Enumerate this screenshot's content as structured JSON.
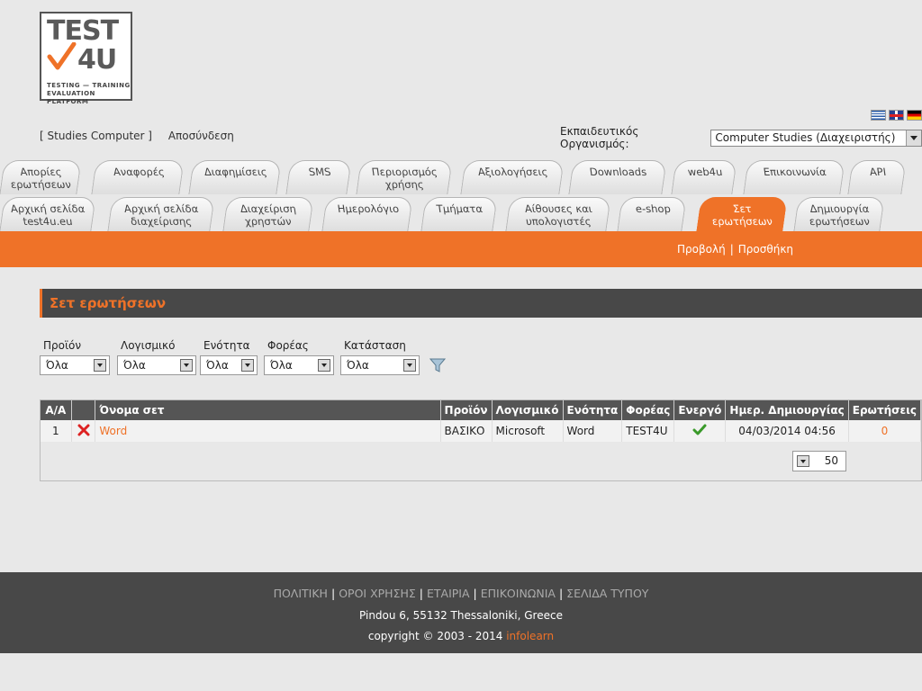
{
  "logo": {
    "line1": "TEST",
    "line2": "4U",
    "tagline1": "TESTING — TRAINING",
    "tagline2": "EVALUATION PLATFORM"
  },
  "user": {
    "name": "[ Studies Computer ]",
    "logout": "Αποσύνδεση"
  },
  "org": {
    "label": "Εκπαιδευτικός Οργανισμός:",
    "value": "Computer Studies (Διαχειριστής)"
  },
  "tabs_row1": [
    {
      "label1": "Απορίες",
      "label2": "ερωτήσεων"
    },
    {
      "label1": "Αναφορές",
      "label2": ""
    },
    {
      "label1": "Διαφημίσεις",
      "label2": ""
    },
    {
      "label1": "SMS",
      "label2": ""
    },
    {
      "label1": "Περιορισμός",
      "label2": "χρήσης"
    },
    {
      "label1": "Αξιολογήσεις",
      "label2": ""
    },
    {
      "label1": "Downloads",
      "label2": ""
    },
    {
      "label1": "web4u",
      "label2": ""
    },
    {
      "label1": "Επικοινωνία",
      "label2": ""
    },
    {
      "label1": "API",
      "label2": ""
    }
  ],
  "tabs_row2": [
    {
      "label1": "Αρχική σελίδα",
      "label2": "test4u.eu"
    },
    {
      "label1": "Αρχική σελίδα",
      "label2": "διαχείρισης"
    },
    {
      "label1": "Διαχείριση",
      "label2": "χρηστών"
    },
    {
      "label1": "Ημερολόγιο",
      "label2": ""
    },
    {
      "label1": "Τμήματα",
      "label2": ""
    },
    {
      "label1": "Αίθουσες και",
      "label2": "υπολογιστές"
    },
    {
      "label1": "e-shop",
      "label2": ""
    },
    {
      "label1": "Σετ",
      "label2": "ερωτήσεων"
    },
    {
      "label1": "Δημιουργία",
      "label2": "ερωτήσεων"
    }
  ],
  "subnav": {
    "view": "Προβολή",
    "sep": "|",
    "add": "Προσθήκη"
  },
  "page_title": "Σετ ερωτήσεων",
  "filters": [
    {
      "label": "Προϊόν",
      "value": "Όλα"
    },
    {
      "label": "Λογισμικό",
      "value": "Όλα"
    },
    {
      "label": "Ενότητα",
      "value": "Όλα"
    },
    {
      "label": "Φορέας",
      "value": "Όλα"
    },
    {
      "label": "Κατάσταση",
      "value": "Όλα"
    }
  ],
  "table": {
    "headers": [
      "Α/Α",
      "",
      "Όνομα σετ",
      "Προϊόν",
      "Λογισμικό",
      "Ενότητα",
      "Φορέας",
      "Ενεργό",
      "Ημερ. Δημιουργίας",
      "Ερωτήσεις"
    ],
    "rows": [
      {
        "aa": "1",
        "name": "Word",
        "product": "ΒΑΣΙΚΟ",
        "software": "Microsoft",
        "unit": "Word",
        "provider": "TEST4U",
        "created": "04/03/2014 04:56",
        "questions": "0"
      }
    ],
    "page_size": "50"
  },
  "footer": {
    "links": [
      "ΠΟΛΙΤΙΚΗ",
      "ΟΡΟΙ ΧΡΗΣΗΣ",
      "ΕΤΑΙΡΙΑ",
      "ΕΠΙΚΟΙΝΩΝΙΑ",
      "ΣΕΛΙΔΑ ΤΥΠΟΥ"
    ],
    "sep": "|",
    "address": "Pindou 6, 55132 Thessaloniki, Greece",
    "copyright": "copyright © 2003 - 2014",
    "company": "infolearn"
  },
  "colors": {
    "accent": "#ef7228",
    "dark": "#484848"
  }
}
